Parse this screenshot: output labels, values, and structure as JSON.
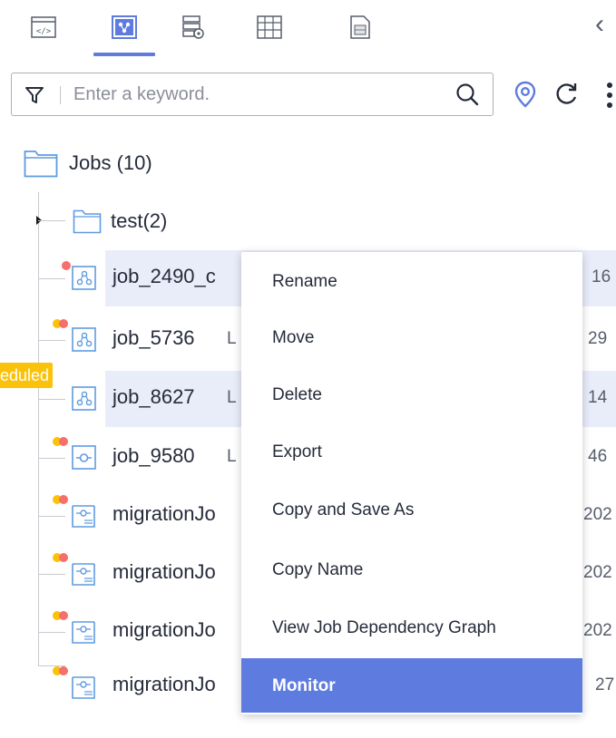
{
  "toolbar": {
    "tabs": [
      {
        "icon": "code-tag-icon"
      },
      {
        "icon": "job-flow-icon",
        "active": true
      },
      {
        "icon": "database-settings-icon"
      },
      {
        "icon": "table-grid-icon"
      },
      {
        "icon": "document-list-icon"
      }
    ],
    "collapse_icon": "chevron-left-icon",
    "accent_color": "#5e7ce0"
  },
  "search": {
    "placeholder": "Enter a keyword.",
    "value": ""
  },
  "tree": {
    "root": {
      "name": "Jobs",
      "count": "(10)"
    },
    "folders": [
      {
        "name": "test",
        "count": "(2)"
      }
    ],
    "jobs": [
      {
        "name": "job_2490_c",
        "suffix": "16",
        "selected": true
      },
      {
        "name": "job_5736",
        "prefix_letter": "L",
        "suffix": "29"
      },
      {
        "name": "job_8627",
        "prefix_letter": "L",
        "suffix": "14",
        "selected": true
      },
      {
        "name": "job_9580",
        "prefix_letter": "L",
        "suffix": "46"
      },
      {
        "name": "migrationJo",
        "suffix": "202"
      },
      {
        "name": "migrationJo",
        "suffix": "202"
      },
      {
        "name": "migrationJo",
        "suffix": "202"
      },
      {
        "name": "migrationJo",
        "suffix": "27"
      }
    ]
  },
  "badge": {
    "text": "eduled"
  },
  "context_menu": {
    "items": [
      {
        "label": "Rename"
      },
      {
        "label": "Move"
      },
      {
        "label": "Delete"
      },
      {
        "label": "Export"
      },
      {
        "label": "Copy and Save As"
      },
      {
        "label": "Copy Name"
      },
      {
        "label": "View Job Dependency Graph"
      },
      {
        "label": "Monitor",
        "active": true
      }
    ]
  }
}
